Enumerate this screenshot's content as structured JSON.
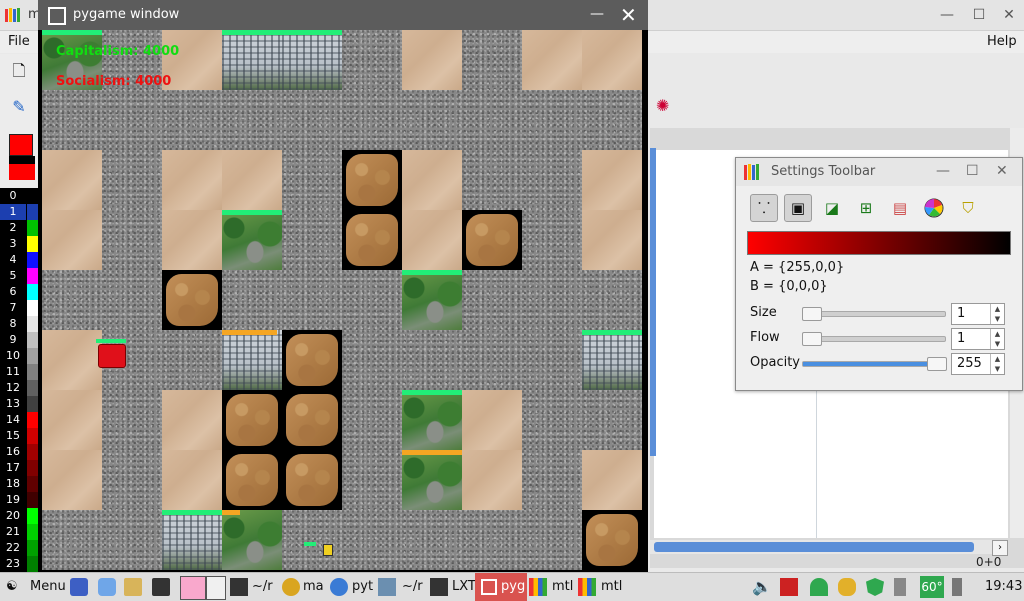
{
  "background_app": {
    "title": "m",
    "menu": {
      "file": "File",
      "help": "Help"
    },
    "palette": [
      "0",
      "1",
      "2",
      "3",
      "4",
      "5",
      "6",
      "7",
      "8",
      "9",
      "10",
      "11",
      "12",
      "13",
      "14",
      "15",
      "16",
      "17",
      "18",
      "19",
      "20",
      "21",
      "22",
      "23"
    ],
    "palette_colors": [
      "#000000",
      "#1c3fb0",
      "#00c000",
      "#ffff00",
      "#1010ff",
      "#ff00ff",
      "#00ffff",
      "#ffffff",
      "#e6e6e6",
      "#c0c0c0",
      "#a0a0a0",
      "#808080",
      "#606060",
      "#404040",
      "#ff0000",
      "#d00000",
      "#a00000",
      "#800000",
      "#600000",
      "#400000",
      "#00ff00",
      "#00d000",
      "#00a000",
      "#008000"
    ],
    "status_coords": "0+0"
  },
  "pygame": {
    "title": "pygame window",
    "score_capitalism": "Capitalism: 4000",
    "score_socialism": "Socialism: 4000"
  },
  "settings": {
    "title": "Settings Toolbar",
    "color_a": "A = {255,0,0}",
    "color_b": "B = {0,0,0}",
    "size_label": "Size",
    "size_value": "1",
    "flow_label": "Flow",
    "flow_value": "1",
    "opacity_label": "Opacity",
    "opacity_value": "255",
    "opacity_level": 1.0,
    "size_level": 0.0,
    "flow_level": 0.0
  },
  "taskbar": {
    "menu": "Menu",
    "items": [
      "~/r",
      "ma",
      "pyt",
      "~/r",
      "LXT",
      "pyg",
      "mtl",
      "mtl"
    ],
    "temperature": "60°",
    "clock": "19:43"
  }
}
